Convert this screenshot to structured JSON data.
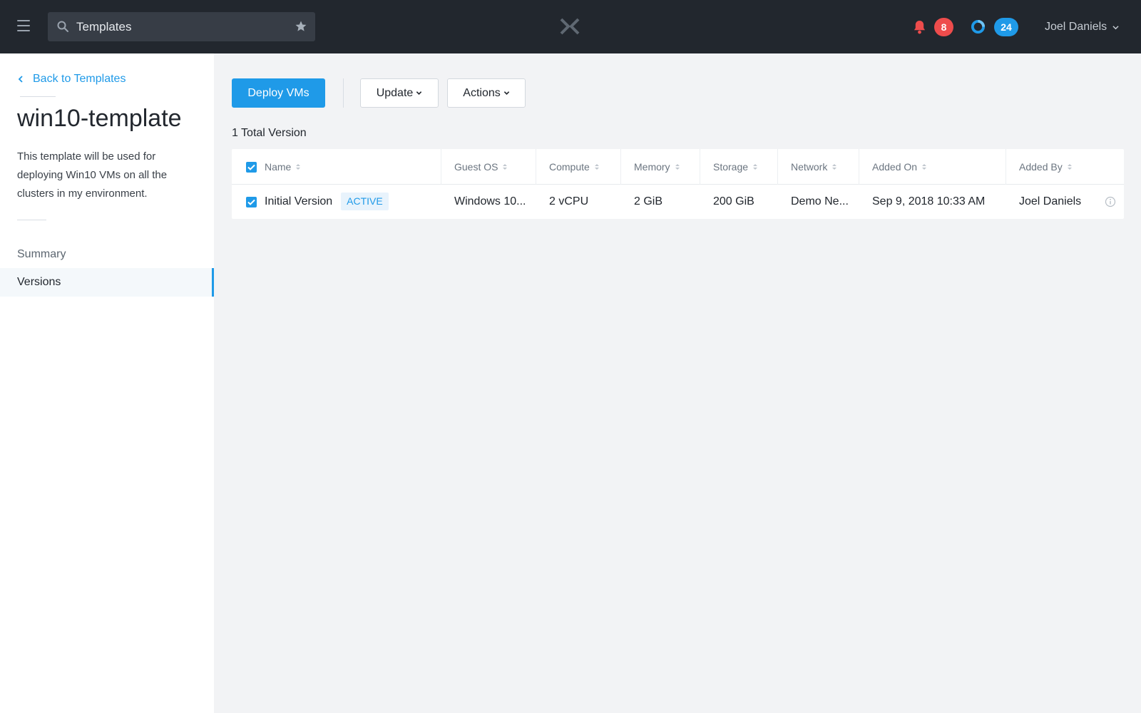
{
  "header": {
    "search_value": "Templates",
    "alert_count": "8",
    "task_count": "24",
    "user_name": "Joel Daniels"
  },
  "sidebar": {
    "back_label": "Back to Templates",
    "title": "win10-template",
    "description": "This template will be used for deploying Win10 VMs on all the clusters in my environment.",
    "nav": [
      {
        "label": "Summary",
        "active": false
      },
      {
        "label": "Versions",
        "active": true
      }
    ]
  },
  "toolbar": {
    "deploy_label": "Deploy VMs",
    "update_label": "Update",
    "actions_label": "Actions"
  },
  "summary": {
    "total_label": "1 Total Version"
  },
  "table": {
    "columns": [
      "Name",
      "Guest OS",
      "Compute",
      "Memory",
      "Storage",
      "Network",
      "Added On",
      "Added By"
    ],
    "rows": [
      {
        "name": "Initial Version",
        "status": "ACTIVE",
        "guest_os": "Windows 10...",
        "compute": "2 vCPU",
        "memory": "2 GiB",
        "storage": "200 GiB",
        "network": "Demo Ne...",
        "added_on": "Sep 9, 2018 10:33 AM",
        "added_by": "Joel Daniels",
        "selected": true
      }
    ]
  },
  "colors": {
    "accent": "#1f9ae8",
    "topbar": "#22272e",
    "alert": "#ee4c4c"
  }
}
